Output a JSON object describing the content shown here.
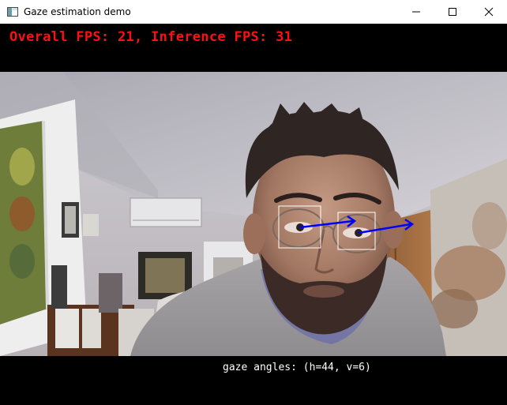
{
  "window": {
    "title": "Gaze estimation demo"
  },
  "controls": {
    "minimize_icon": "minimize-icon",
    "maximize_icon": "maximize-icon",
    "close_icon": "close-icon"
  },
  "overlay": {
    "fps_text": "Overall FPS: 21, Inference FPS: 31",
    "fps_color": "#ff1010",
    "gaze_text": "gaze angles: (h=44, v=6)",
    "gaze_color": "#ffffff",
    "eye_box_color": "#ffffff",
    "gaze_arrow_color": "#0000ff"
  }
}
